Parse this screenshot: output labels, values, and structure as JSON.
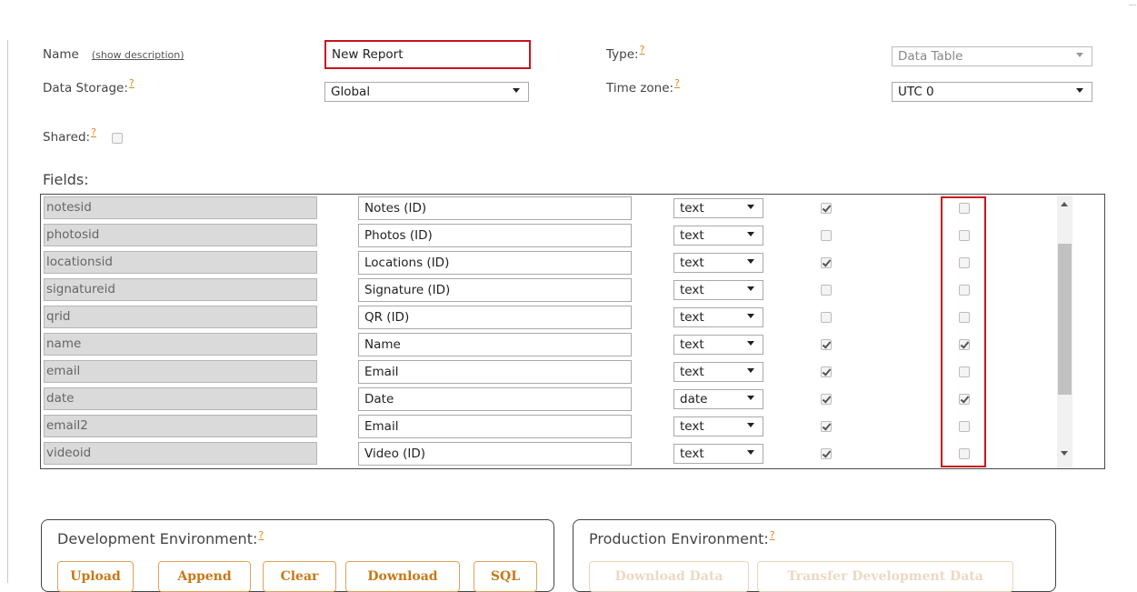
{
  "header": {
    "name_label": "Name",
    "show_description": "(show description)",
    "name_value": "New Report",
    "type_label": "Type:",
    "type_value": "Data Table",
    "storage_label": "Data Storage:",
    "storage_value": "Global",
    "timezone_label": "Time zone:",
    "timezone_value": "UTC 0",
    "shared_label": "Shared:",
    "shared_checked": false,
    "help_glyph": "?"
  },
  "fields": {
    "title": "Fields:",
    "rows": [
      {
        "name": "notesid",
        "label": "Notes (ID)",
        "type": "text",
        "check1": true,
        "check2": false
      },
      {
        "name": "photosid",
        "label": "Photos (ID)",
        "type": "text",
        "check1": false,
        "check2": false
      },
      {
        "name": "locationsid",
        "label": "Locations (ID)",
        "type": "text",
        "check1": true,
        "check2": false
      },
      {
        "name": "signatureid",
        "label": "Signature (ID)",
        "type": "text",
        "check1": false,
        "check2": false
      },
      {
        "name": "qrid",
        "label": "QR (ID)",
        "type": "text",
        "check1": false,
        "check2": false
      },
      {
        "name": "name",
        "label": "Name",
        "type": "text",
        "check1": true,
        "check2": true
      },
      {
        "name": "email",
        "label": "Email",
        "type": "text",
        "check1": true,
        "check2": false
      },
      {
        "name": "date",
        "label": "Date",
        "type": "date",
        "check1": true,
        "check2": true
      },
      {
        "name": "email2",
        "label": "Email",
        "type": "text",
        "check1": true,
        "check2": false
      },
      {
        "name": "videoid",
        "label": "Video (ID)",
        "type": "text",
        "check1": true,
        "check2": false
      }
    ]
  },
  "development": {
    "title": "Development Environment:",
    "buttons": [
      "Upload",
      "Append",
      "Clear",
      "Download",
      "SQL"
    ]
  },
  "production": {
    "title": "Production Environment:",
    "buttons": [
      "Download Data",
      "Transfer Development Data"
    ]
  },
  "colors": {
    "accent": "#e08a1e",
    "highlight": "#c8141e"
  }
}
